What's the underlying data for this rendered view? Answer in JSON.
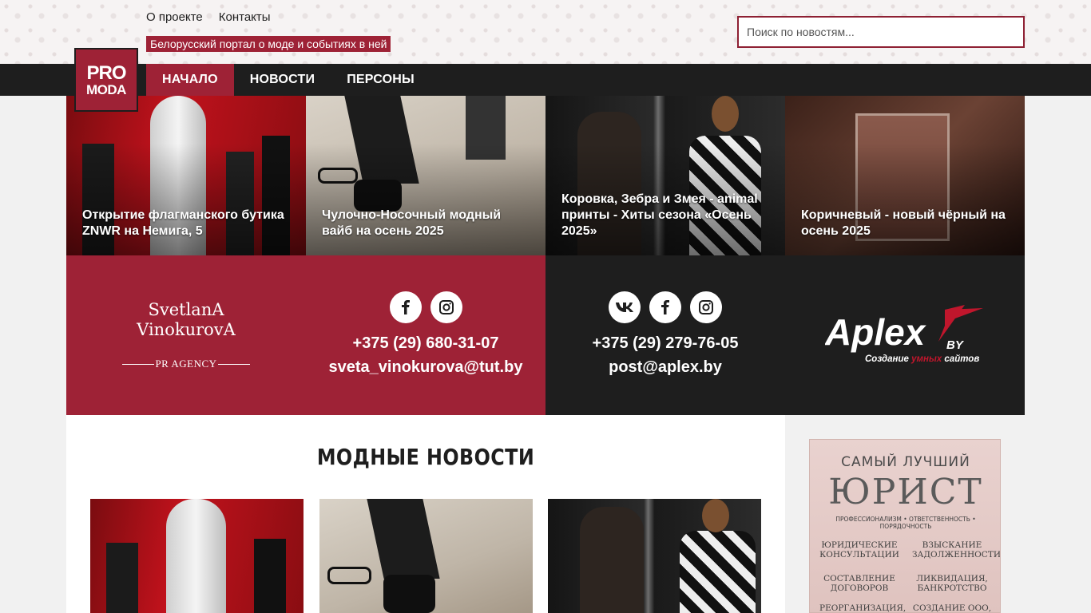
{
  "header": {
    "links": [
      "О проекте",
      "Контакты"
    ],
    "tagline": "Белорусский портал о моде и событиях в ней",
    "search_placeholder": "Поиск по новостям..."
  },
  "logo": {
    "line1": "PRO",
    "line2": "MODA"
  },
  "nav": {
    "items": [
      "НАЧАЛО",
      "НОВОСТИ",
      "ПЕРСОНЫ"
    ],
    "active": "НАЧАЛО"
  },
  "hero": [
    {
      "title": "Открытие флагманского бутика ZNWR на Немига, 5"
    },
    {
      "title": "Чулочно-Носочный модный вайб на осень 2025"
    },
    {
      "title": "Коровка, Зебра и Змея - animal принты - Хиты сезона «Осень 2025»"
    },
    {
      "title": "Коричневый - новый чёрный на осень 2025"
    }
  ],
  "promo": {
    "agency_name_line1": "SvetlanA",
    "agency_name_line2": "VinokurovA",
    "agency_tag": "PR AGENCY",
    "agency_phone": "+375 (29) 680-31-07",
    "agency_email": "sveta_vinokurova@tut.by",
    "aplex_phone": "+375 (29) 279-76-05",
    "aplex_email": "post@aplex.by",
    "aplex_logo": "Aplex",
    "aplex_by": "BY",
    "aplex_slogan_1": "Создание ",
    "aplex_slogan_2": "умных",
    "aplex_slogan_3": " сайтов"
  },
  "main": {
    "section_title": "МОДНЫЕ НОВОСТИ"
  },
  "ad": {
    "line1": "САМЫЙ ЛУЧШИЙ",
    "line2": "ЮРИСТ",
    "line3": "ПРОФЕССИОНАЛИЗМ • ОТВЕТСТВЕННОСТЬ • ПОРЯДОЧНОСТЬ",
    "left_1": "ЮРИДИЧЕСКИЕ КОНСУЛЬТАЦИИ",
    "right_1": "ВЗЫСКАНИЕ ЗАДОЛЖЕННОСТИ",
    "left_2": "СОСТАВЛЕНИЕ ДОГОВОРОВ",
    "right_2": "ЛИКВИДАЦИЯ, БАНКРОТСТВО",
    "left_3": "РЕОРГАНИЗАЦИЯ,",
    "right_3": "СОЗДАНИЕ ООО, ОАО"
  },
  "colors": {
    "accent": "#9e2236",
    "dark": "#1e1e1e"
  }
}
